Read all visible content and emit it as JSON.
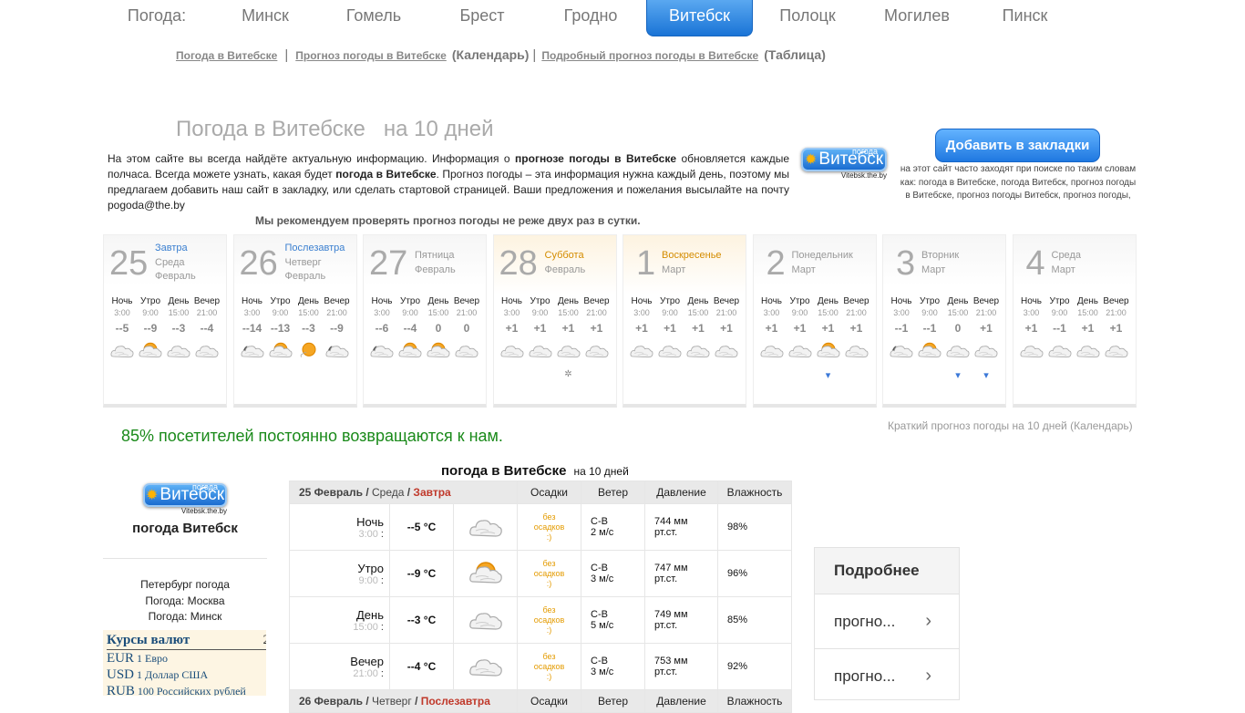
{
  "nav": {
    "items": [
      {
        "label": "Погода:",
        "active": false
      },
      {
        "label": "Минск",
        "active": false
      },
      {
        "label": "Гомель",
        "active": false
      },
      {
        "label": "Брест",
        "active": false
      },
      {
        "label": "Гродно",
        "active": false
      },
      {
        "label": "Витебск",
        "active": true
      },
      {
        "label": "Полоцк",
        "active": false
      },
      {
        "label": "Могилев",
        "active": false
      },
      {
        "label": "Пинск",
        "active": false
      }
    ]
  },
  "sublinks": {
    "link1": "Погода в Витебске",
    "sep": "|",
    "link2": "Прогноз погоды в Витебске",
    "paren2": "(Календарь)",
    "link3": "Подробный прогноз погоды в Витебске",
    "paren3": "(Таблица)"
  },
  "heading": {
    "main": "Погода в Витебске",
    "tail": "на 10 дней"
  },
  "intro": {
    "p1": "На этом сайте вы всегда найдёте актуальную информацию. Информация о ",
    "b1": "прогнозе погоды в Витебске",
    "p2": " обновляется каждые полчаса. Всегда можете узнать, какая будет ",
    "b2": "погода в Витебске",
    "p3": ". Прогноз погоды – эта информация нужна каждый день, поэтому мы предлагаем добавить наш сайт в закладку, или сделать стартовой страницей. Ваши предложения и пожелания высылайте на почту ",
    "email": "pogoda@the.by"
  },
  "logo": {
    "top": "погода",
    "city": "Витебск",
    "url": "Vitebsk.the.by"
  },
  "bookmark": {
    "label": "Добавить в закладки",
    "note": "на этот сайт часто заходят при поиске по таким словам как: погода в Витебске, погода Витебск, прогноз погоды в Витебске, прогноз погоды Витебск, прогноз погоды,"
  },
  "recommend": "Мы рекомендуем проверять прогноз погоды не реже двух раз в сутки.",
  "days": [
    {
      "num": "25",
      "rel": "Завтра",
      "wd": "Среда",
      "mon": "Февраль",
      "weekend": false,
      "slots": [
        {
          "n": "Ночь",
          "t": "3:00",
          "v": "--5",
          "icon": "cloud",
          "p": ""
        },
        {
          "n": "Утро",
          "t": "9:00",
          "v": "--9",
          "icon": "sun-cloud",
          "p": ""
        },
        {
          "n": "День",
          "t": "15:00",
          "v": "--3",
          "icon": "cloud",
          "p": ""
        },
        {
          "n": "Вечер",
          "t": "21:00",
          "v": "--4",
          "icon": "cloud",
          "p": ""
        }
      ]
    },
    {
      "num": "26",
      "rel": "Послезавтра",
      "wd": "Четверг",
      "mon": "Февраль",
      "weekend": false,
      "slots": [
        {
          "n": "Ночь",
          "t": "3:00",
          "v": "--14",
          "icon": "moon-cloud",
          "p": ""
        },
        {
          "n": "Утро",
          "t": "9:00",
          "v": "--13",
          "icon": "sun-cloud",
          "p": ""
        },
        {
          "n": "День",
          "t": "15:00",
          "v": "--3",
          "icon": "sun",
          "p": ""
        },
        {
          "n": "Вечер",
          "t": "21:00",
          "v": "--9",
          "icon": "moon-cloud",
          "p": ""
        }
      ]
    },
    {
      "num": "27",
      "rel": "",
      "wd": "Пятница",
      "mon": "Февраль",
      "weekend": false,
      "slots": [
        {
          "n": "Ночь",
          "t": "3:00",
          "v": "--6",
          "icon": "moon-cloud",
          "p": ""
        },
        {
          "n": "Утро",
          "t": "9:00",
          "v": "--4",
          "icon": "sun-cloud",
          "p": ""
        },
        {
          "n": "День",
          "t": "15:00",
          "v": "0",
          "icon": "sun-cloud",
          "p": ""
        },
        {
          "n": "Вечер",
          "t": "21:00",
          "v": "0",
          "icon": "cloud",
          "p": ""
        }
      ]
    },
    {
      "num": "28",
      "rel": "Суббота",
      "wd": "",
      "mon": "Февраль",
      "weekend": true,
      "slots": [
        {
          "n": "Ночь",
          "t": "3:00",
          "v": "+1",
          "icon": "cloud",
          "p": ""
        },
        {
          "n": "Утро",
          "t": "9:00",
          "v": "+1",
          "icon": "cloud",
          "p": ""
        },
        {
          "n": "День",
          "t": "15:00",
          "v": "+1",
          "icon": "cloud",
          "p": "✲"
        },
        {
          "n": "Вечер",
          "t": "21:00",
          "v": "+1",
          "icon": "cloud",
          "p": ""
        }
      ]
    },
    {
      "num": "1",
      "rel": "Воскресенье",
      "wd": "",
      "mon": "Март",
      "weekend": true,
      "slots": [
        {
          "n": "Ночь",
          "t": "3:00",
          "v": "+1",
          "icon": "cloud",
          "p": ""
        },
        {
          "n": "Утро",
          "t": "9:00",
          "v": "+1",
          "icon": "cloud",
          "p": ""
        },
        {
          "n": "День",
          "t": "15:00",
          "v": "+1",
          "icon": "cloud",
          "p": ""
        },
        {
          "n": "Вечер",
          "t": "21:00",
          "v": "+1",
          "icon": "cloud",
          "p": ""
        }
      ]
    },
    {
      "num": "2",
      "rel": "",
      "wd": "Понедельник",
      "mon": "Март",
      "weekend": false,
      "slots": [
        {
          "n": "Ночь",
          "t": "3:00",
          "v": "+1",
          "icon": "cloud",
          "p": ""
        },
        {
          "n": "Утро",
          "t": "9:00",
          "v": "+1",
          "icon": "cloud",
          "p": ""
        },
        {
          "n": "День",
          "t": "15:00",
          "v": "+1",
          "icon": "sun-cloud",
          "p": "💧"
        },
        {
          "n": "Вечер",
          "t": "21:00",
          "v": "+1",
          "icon": "cloud",
          "p": ""
        }
      ]
    },
    {
      "num": "3",
      "rel": "",
      "wd": "Вторник",
      "mon": "Март",
      "weekend": false,
      "slots": [
        {
          "n": "Ночь",
          "t": "3:00",
          "v": "--1",
          "icon": "moon-cloud",
          "p": ""
        },
        {
          "n": "Утро",
          "t": "9:00",
          "v": "--1",
          "icon": "sun-cloud",
          "p": ""
        },
        {
          "n": "День",
          "t": "15:00",
          "v": "0",
          "icon": "cloud",
          "p": "💧"
        },
        {
          "n": "Вечер",
          "t": "21:00",
          "v": "+1",
          "icon": "cloud",
          "p": "💧"
        }
      ]
    },
    {
      "num": "4",
      "rel": "",
      "wd": "Среда",
      "mon": "Март",
      "weekend": false,
      "slots": [
        {
          "n": "Ночь",
          "t": "3:00",
          "v": "+1",
          "icon": "cloud",
          "p": ""
        },
        {
          "n": "Утро",
          "t": "9:00",
          "v": "--1",
          "icon": "cloud",
          "p": ""
        },
        {
          "n": "День",
          "t": "15:00",
          "v": "+1",
          "icon": "cloud",
          "p": ""
        },
        {
          "n": "Вечер",
          "t": "21:00",
          "v": "+1",
          "icon": "cloud",
          "p": ""
        }
      ]
    }
  ],
  "loyal": "85% посетителей постоянно возвращаются к нам.",
  "brief": "Краткий прогноз погоды на 10 дней (Календарь)",
  "sidebar": {
    "title": "погода Витебск",
    "links": [
      "Петербург погода",
      "Погода: Москва",
      "Погода: Минск"
    ]
  },
  "currency": {
    "title": "Курсы валют",
    "tail": "2",
    "rows": [
      {
        "code": "EUR",
        "desc": "1 Евро"
      },
      {
        "code": "USD",
        "desc": "1 Доллар США"
      },
      {
        "code": "RUB",
        "desc": "100 Российских рублей"
      }
    ]
  },
  "table": {
    "title": "погода в Витебске",
    "subtitle": "на 10 дней",
    "header": {
      "date": "25 Февраль /",
      "wd": "Среда",
      "slash": "/",
      "rel": "Завтра",
      "c_precip": "Осадки",
      "c_wind": "Ветер",
      "c_press": "Давление",
      "c_hum": "Влажность"
    },
    "rows": [
      {
        "n": "Ночь",
        "t": "3:00",
        "temp": "--5 °C",
        "icon": "cloud",
        "precip": "без осадков :)",
        "dir": "С-В",
        "speed": "2 м/с",
        "press": "744 мм",
        "unit": "рт.ст.",
        "hum": "98%"
      },
      {
        "n": "Утро",
        "t": "9:00",
        "temp": "--9 °C",
        "icon": "sun-cloud",
        "precip": "без осадков :)",
        "dir": "С-В",
        "speed": "3 м/с",
        "press": "747 мм",
        "unit": "рт.ст.",
        "hum": "96%"
      },
      {
        "n": "День",
        "t": "15:00",
        "temp": "--3 °C",
        "icon": "cloud",
        "precip": "без осадков :)",
        "dir": "С-В",
        "speed": "5 м/с",
        "press": "749 мм",
        "unit": "рт.ст.",
        "hum": "85%"
      },
      {
        "n": "Вечер",
        "t": "21:00",
        "temp": "--4 °C",
        "icon": "cloud",
        "precip": "без осадков :)",
        "dir": "С-В",
        "speed": "3 м/с",
        "press": "753 мм",
        "unit": "рт.ст.",
        "hum": "92%"
      }
    ],
    "header2": {
      "date": "26 Февраль /",
      "wd": "Четверг",
      "slash": "/",
      "rel": "Послезавтра",
      "c_precip": "Осадки",
      "c_wind": "Ветер",
      "c_press": "Давление",
      "c_hum": "Влажность"
    }
  },
  "widget": {
    "title": "Подробнее",
    "rows": [
      "прогно...",
      "прогно..."
    ]
  },
  "colors": {
    "accent": "#1a74d6",
    "weekend": "#d48c00",
    "green": "#1a8a1a",
    "precip": "#e49b00",
    "rel_red": "#c0392b"
  }
}
